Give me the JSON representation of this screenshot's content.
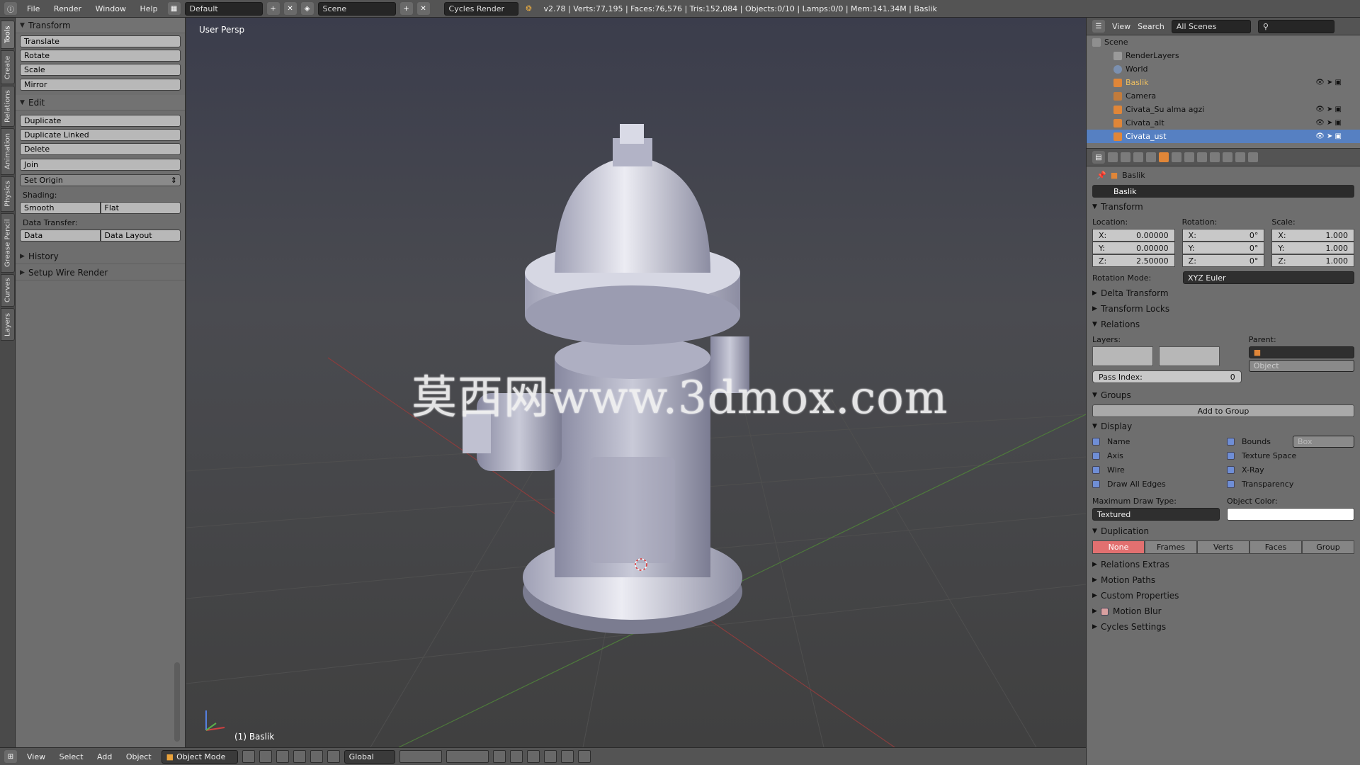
{
  "topbar": {
    "menus": [
      "File",
      "Render",
      "Window",
      "Help"
    ],
    "layout": "Default",
    "scene": "Scene",
    "engine": "Cycles Render",
    "stats": "v2.78 | Verts:77,195 | Faces:76,576 | Tris:152,084 | Objects:0/10 | Lamps:0/0 | Mem:141.34M | Baslik"
  },
  "lefttabs": [
    "Tools",
    "Create",
    "Relations",
    "Animation",
    "Physics",
    "Grease Pencil",
    "Curves",
    "Layers"
  ],
  "toolshelf": {
    "transform_header": "Transform",
    "transform_buttons": [
      "Translate",
      "Rotate",
      "Scale",
      "Mirror"
    ],
    "edit_header": "Edit",
    "edit_buttons": [
      "Duplicate",
      "Duplicate Linked",
      "Delete"
    ],
    "join": "Join",
    "set_origin": "Set Origin",
    "shading_label": "Shading:",
    "smooth": "Smooth",
    "flat": "Flat",
    "data_transfer_label": "Data Transfer:",
    "data": "Data",
    "data_layout": "Data Layout",
    "history": "History",
    "setup_wire": "Setup Wire Render"
  },
  "viewport": {
    "label": "User Persp",
    "object": "(1) Baslik",
    "watermark": "莫西网www.3dmox.com"
  },
  "bottombar": {
    "menus": [
      "View",
      "Select",
      "Add",
      "Object"
    ],
    "mode": "Object Mode",
    "orientation": "Global"
  },
  "outliner": {
    "menus": [
      "View",
      "Search"
    ],
    "filter": "All Scenes",
    "rows": [
      "Scene",
      "RenderLayers",
      "World",
      "Baslik",
      "Camera",
      "Civata_Su alma agzi",
      "Civata_alt",
      "Civata_ust"
    ]
  },
  "properties": {
    "breadcrumb": "Baslik",
    "name": "Baslik",
    "transform_header": "Transform",
    "location_label": "Location:",
    "rotation_label": "Rotation:",
    "scale_label": "Scale:",
    "location": [
      [
        "X:",
        "0.00000"
      ],
      [
        "Y:",
        "0.00000"
      ],
      [
        "Z:",
        "2.50000"
      ]
    ],
    "rotation": [
      [
        "X:",
        "0°"
      ],
      [
        "Y:",
        "0°"
      ],
      [
        "Z:",
        "0°"
      ]
    ],
    "scale": [
      [
        "X:",
        "1.000"
      ],
      [
        "Y:",
        "1.000"
      ],
      [
        "Z:",
        "1.000"
      ]
    ],
    "rotation_mode_label": "Rotation Mode:",
    "rotation_mode": "XYZ Euler",
    "delta_transform": "Delta Transform",
    "transform_locks": "Transform Locks",
    "relations_header": "Relations",
    "layers_label": "Layers:",
    "parent_label": "Parent:",
    "parent_type": "Object",
    "pass_index_label": "Pass Index:",
    "pass_index": "0",
    "groups_header": "Groups",
    "add_to_group": "Add to Group",
    "display_header": "Display",
    "display_left": [
      "Name",
      "Axis",
      "Wire",
      "Draw All Edges"
    ],
    "display_right": [
      "Bounds",
      "Texture Space",
      "X-Ray",
      "Transparency"
    ],
    "bounds_type": "Box",
    "max_draw_label": "Maximum Draw Type:",
    "max_draw": "Textured",
    "object_color_label": "Object Color:",
    "duplication_header": "Duplication",
    "duplication": [
      "None",
      "Frames",
      "Verts",
      "Faces",
      "Group"
    ],
    "collapsed": [
      "Relations Extras",
      "Motion Paths",
      "Custom Properties",
      "Motion Blur",
      "Cycles Settings"
    ]
  }
}
